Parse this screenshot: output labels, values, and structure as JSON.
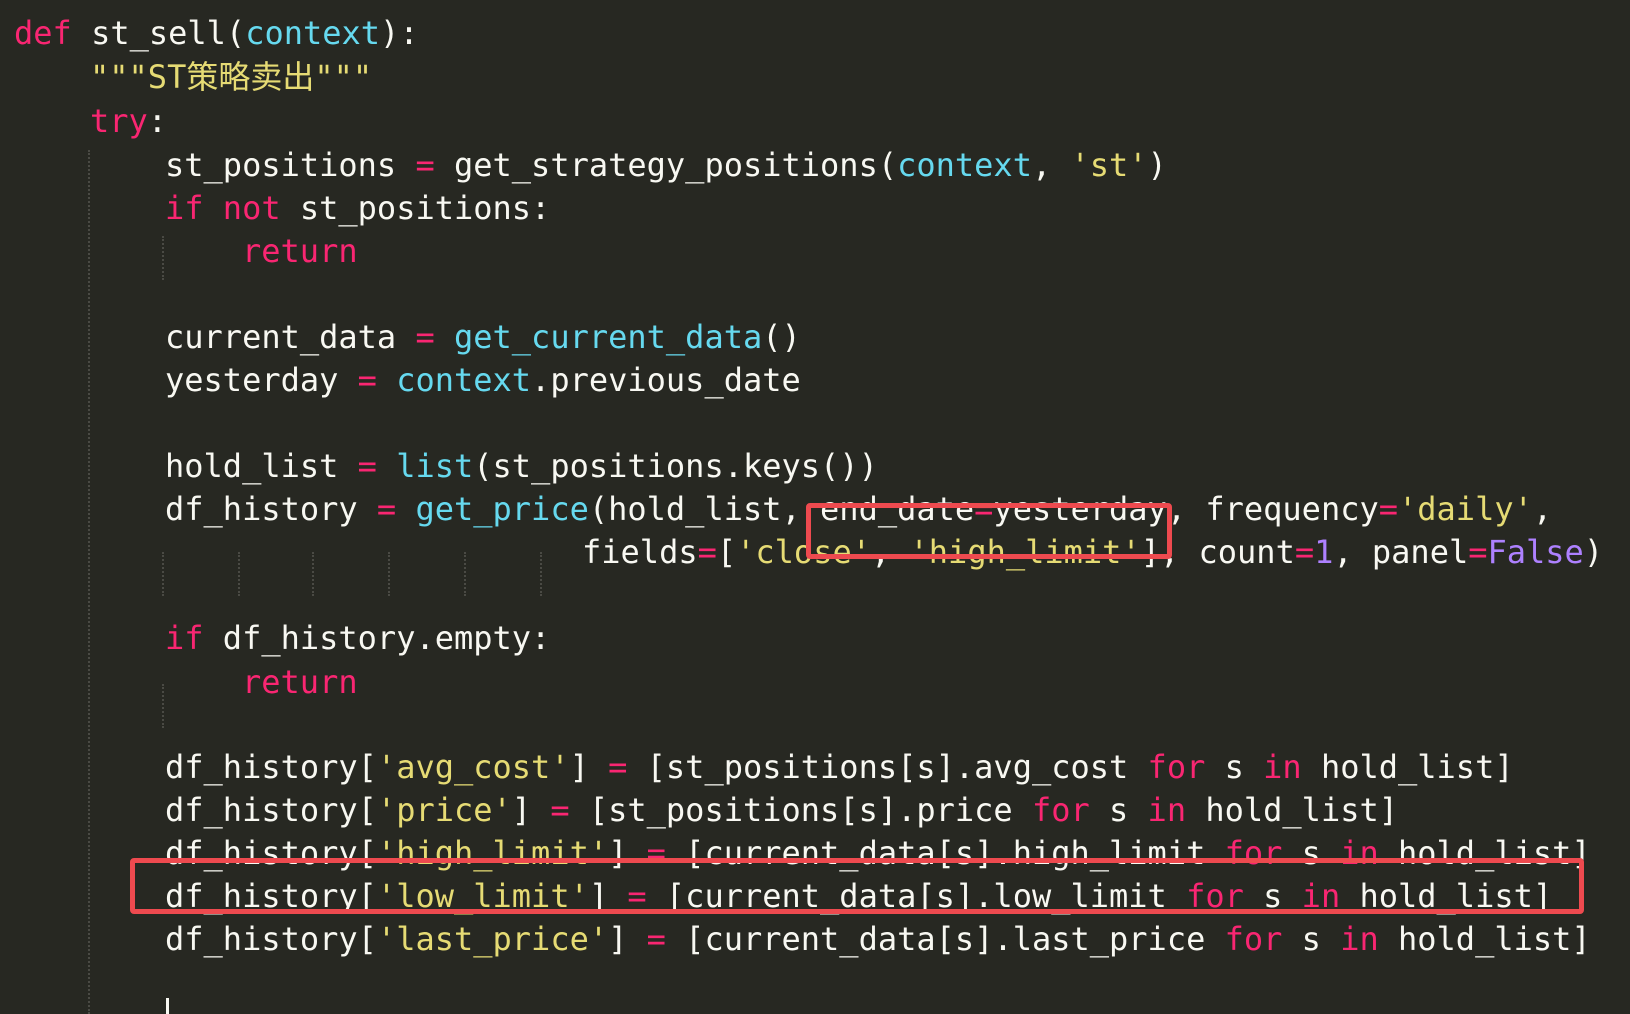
{
  "editor": {
    "language": "python",
    "theme_colors": {
      "background": "#272822",
      "keyword": "#f92672",
      "builtin": "#66d9ef",
      "string": "#e6db74",
      "number": "#ae81ff",
      "text": "#f8f8f2",
      "highlight_box": "#ee4a4f"
    }
  },
  "code": {
    "l1": {
      "def": "def",
      "name": " st_sell(",
      "param": "context",
      "end": "):"
    },
    "l2": {
      "doc_open": "\"\"\"ST",
      "doc_cn": "策略卖出",
      "doc_close": "\"\"\""
    },
    "l3": {
      "kw": "try",
      "colon": ":"
    },
    "l4": {
      "a": "st_positions ",
      "eq": "=",
      "b": " get_strategy_positions(",
      "c": "context",
      "d": ", ",
      "e": "'st'",
      "f": ")"
    },
    "l5": {
      "kw1": "if",
      "sp": " ",
      "kw2": "not",
      "rest": " st_positions:"
    },
    "l6": {
      "kw": "return"
    },
    "l7": {
      "a": "current_data ",
      "eq": "=",
      "sp": " ",
      "fn": "get_current_data",
      "end": "()"
    },
    "l8": {
      "a": "yesterday ",
      "eq": "=",
      "sp": " ",
      "ctx": "context",
      "rest": ".previous_date"
    },
    "l9": {
      "a": "hold_list ",
      "eq": "=",
      "sp": " ",
      "fn": "list",
      "rest": "(st_positions.keys())"
    },
    "l10": {
      "a": "df_history ",
      "eq": "=",
      "sp": " ",
      "fn": "get_price",
      "b": "(hold_list, ",
      "c": "end_date",
      "eq2": "=",
      "d": "yesterday, frequency",
      "eq3": "=",
      "e": "'daily'",
      "f": ","
    },
    "l11": {
      "a": "fields",
      "eq": "=",
      "b": "[",
      "s1": "'close'",
      "c": ", ",
      "s2": "'high_limit'",
      "d": "], count",
      "eq2": "=",
      "n1": "1",
      "e": ", panel",
      "eq3": "=",
      "v": "False",
      "f": ")"
    },
    "l12": {
      "kw": "if",
      "rest": " df_history.empty:"
    },
    "l13": {
      "kw": "return"
    },
    "l14": {
      "a": "df_history[",
      "s": "'avg_cost'",
      "b": "] ",
      "eq": "=",
      "c": " [st_positions[s].avg_cost ",
      "kw1": "for",
      "d": " s ",
      "kw2": "in",
      "e": " hold_list]"
    },
    "l15": {
      "a": "df_history[",
      "s": "'price'",
      "b": "] ",
      "eq": "=",
      "c": " [st_positions[s].price ",
      "kw1": "for",
      "d": " s ",
      "kw2": "in",
      "e": " hold_list]"
    },
    "l16": {
      "a": "df_history[",
      "s": "'high_limit'",
      "b": "] ",
      "eq": "=",
      "c": " [current_data[s].high_limit ",
      "kw1": "for",
      "d": " s ",
      "kw2": "in",
      "e": " hold_list]"
    },
    "l17": {
      "a": "df_history[",
      "s": "'low_limit'",
      "b": "] ",
      "eq": "=",
      "c": " [current_data[s].low_limit ",
      "kw1": "for",
      "d": " s ",
      "kw2": "in",
      "e": " hold_list]"
    },
    "l18": {
      "a": "df_history[",
      "s": "'last_price'",
      "b": "] ",
      "eq": "=",
      "c": " [current_data[s].last_price ",
      "kw1": "for",
      "d": " s ",
      "kw2": "in",
      "e": " hold_list]"
    }
  }
}
